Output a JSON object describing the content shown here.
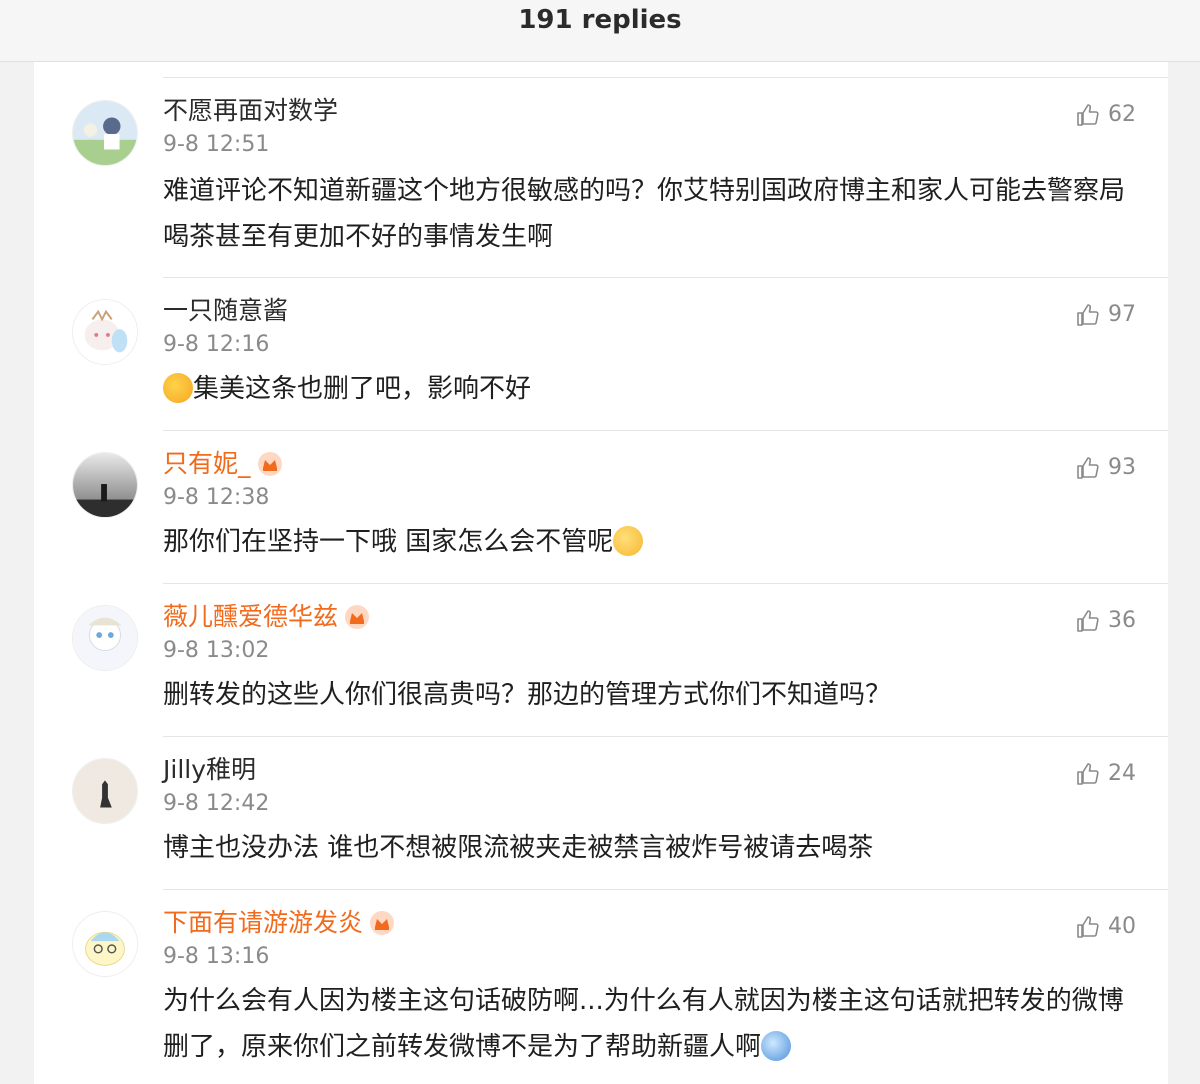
{
  "header": {
    "title": "191 replies"
  },
  "colors": {
    "vip_name": "#f26a1b",
    "text": "#1f1f1f",
    "meta": "#8a8a8a"
  },
  "comments": [
    {
      "user": "不愿再面对数学",
      "vip": false,
      "time": "9-8 12:51",
      "likes": "62",
      "text": "难道评论不知道新疆这个地方很敏感的吗？你艾特别国政府博主和家人可能去警察局喝茶甚至有更加不好的事情发生啊"
    },
    {
      "user": "一只随意酱",
      "vip": false,
      "time": "9-8 12:16",
      "likes": "97",
      "text": "集美这条也删了吧，影响不好",
      "leading_emoji": "thinking-face-emoji"
    },
    {
      "user": "只有妮_",
      "vip": true,
      "time": "9-8 12:38",
      "likes": "93",
      "text": "那你们在坚持一下哦 国家怎么会不管呢",
      "trailing_emoji": "flower-face-emoji"
    },
    {
      "user": "薇儿醺爱德华兹",
      "vip": true,
      "time": "9-8 13:02",
      "likes": "36",
      "text": "删转发的这些人你们很高贵吗？那边的管理方式你们不知道吗？"
    },
    {
      "user": "Jilly稚明",
      "vip": false,
      "time": "9-8 12:42",
      "likes": "24",
      "text": "博主也没办法 谁也不想被限流被夹走被禁言被炸号被请去喝茶"
    },
    {
      "user": "下面有请游游发炎",
      "vip": true,
      "time": "9-8 13:16",
      "likes": "40",
      "text": "为什么会有人因为楼主这句话破防啊...为什么有人就因为楼主这句话就把转发的微博删了，原来你们之前转发微博不是为了帮助新疆人啊",
      "trailing_emoji": "shocked-face-emoji"
    }
  ]
}
